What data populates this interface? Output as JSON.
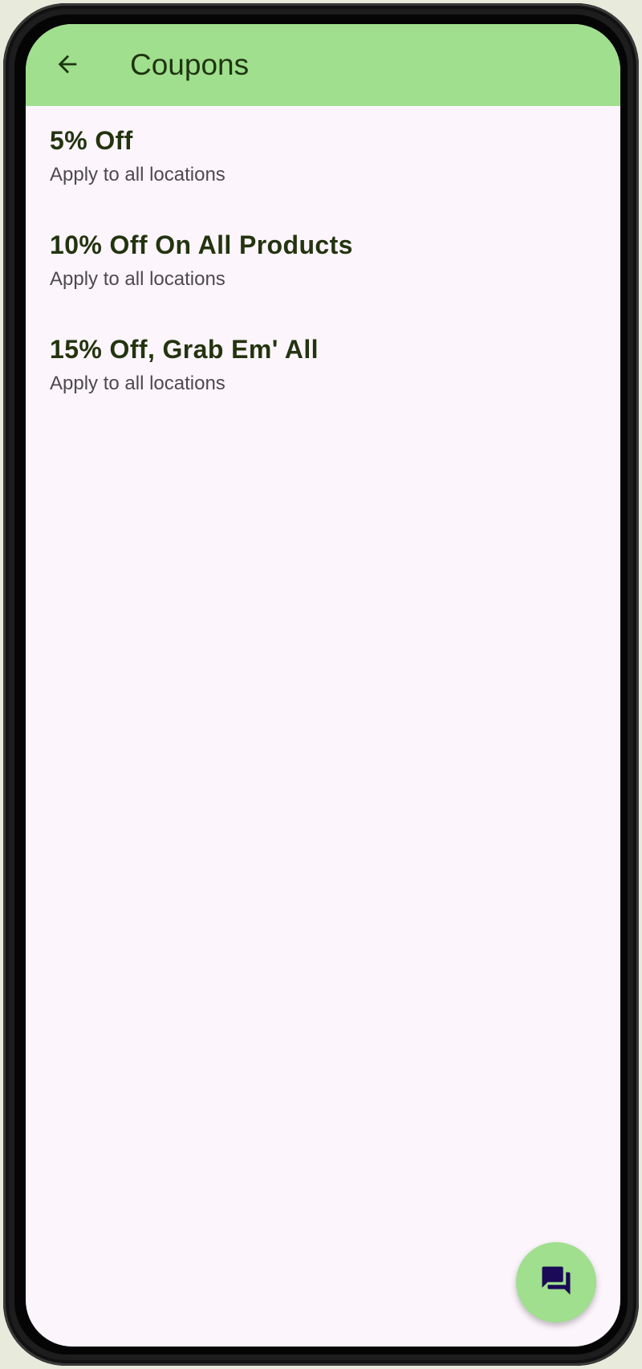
{
  "app_bar": {
    "title": "Coupons",
    "back_icon": "arrow-back-icon"
  },
  "coupons": [
    {
      "title": "5% Off",
      "subtitle": "Apply to all locations"
    },
    {
      "title": "10% Off On All Products",
      "subtitle": "Apply to all locations"
    },
    {
      "title": "15% Off, Grab Em' All",
      "subtitle": "Apply to all locations"
    }
  ],
  "fab": {
    "icon": "chat-bubbles-icon"
  },
  "colors": {
    "app_bar_background": "#9fdf8d",
    "screen_background": "#fcf5fc",
    "title_text": "#23340f",
    "subtitle_text": "#4d4a4f",
    "fab_background": "#9fdf8d",
    "fab_icon": "#1b0a57"
  }
}
